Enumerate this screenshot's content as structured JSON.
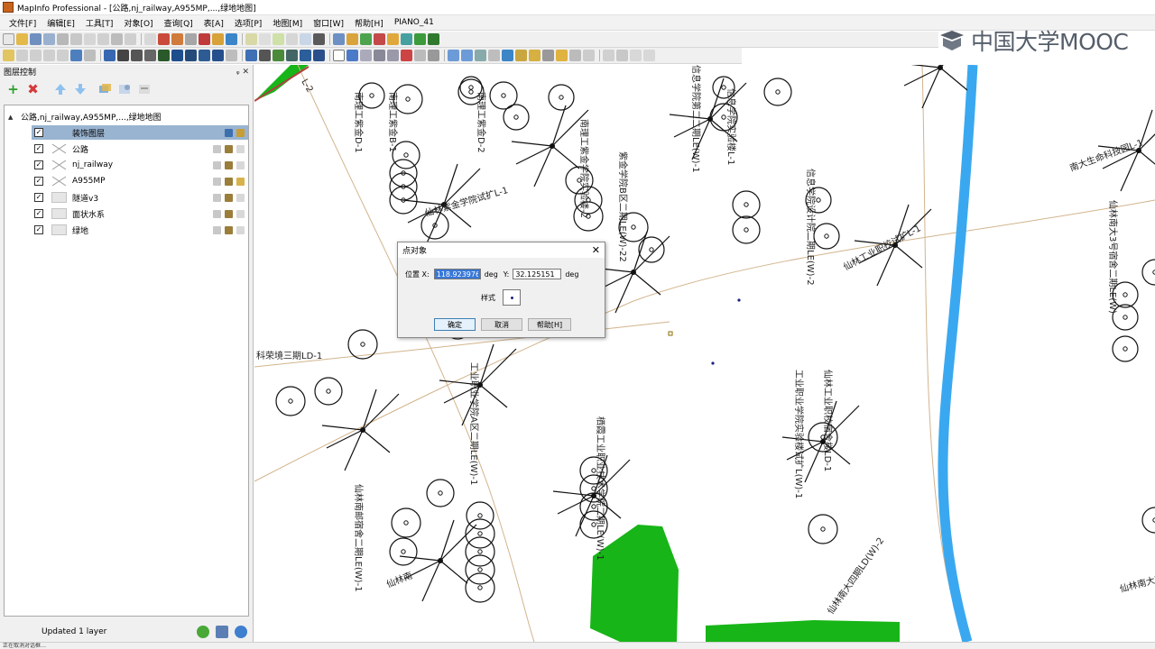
{
  "window": {
    "title": "MapInfo Professional - [公路,nj_railway,A955MP,...,绿地地图]"
  },
  "menu": {
    "items": [
      "文件[F]",
      "编辑[E]",
      "工具[T]",
      "对象[O]",
      "查询[Q]",
      "表[A]",
      "选项[P]",
      "地图[M]",
      "窗口[W]",
      "帮助[H]",
      "PIANO_41"
    ]
  },
  "logo": {
    "text": "中国大学MOOC",
    "color": "#555e6a"
  },
  "layer_panel": {
    "title": "图层控制",
    "header_buttons": "ᵩ ✕",
    "add_icon": "+",
    "remove_icon": "✖",
    "root_label": "公路,nj_railway,A955MP,...,绿地地图",
    "root_expander": "▲",
    "layers": [
      {
        "name": "装饰图层",
        "checked": "✓",
        "selected": true
      },
      {
        "name": "公路",
        "checked": "✓"
      },
      {
        "name": "nj_railway",
        "checked": "✓"
      },
      {
        "name": "A955MP",
        "checked": "✓"
      },
      {
        "name": "隧道v3",
        "checked": "✓"
      },
      {
        "name": "面状水系",
        "checked": "✓"
      },
      {
        "name": "绿地",
        "checked": "✓"
      }
    ],
    "status_text": "Updated 1 layer"
  },
  "dialog": {
    "title": "点对象",
    "close": "✕",
    "position_label": "位置 X:",
    "x_value": "118.923976",
    "x_unit": "deg",
    "y_label": "Y:",
    "y_value": "32.125151",
    "y_unit": "deg",
    "style_label": "样式",
    "ok_label": "确定",
    "cancel_label": "取消",
    "help_label": "帮助[H]"
  },
  "map": {
    "colors": {
      "river": "#3aa8f0",
      "green": "#17b517",
      "road": "#d2b48c",
      "symbol": "#111111"
    },
    "labels": [
      "南理工紫金D-1",
      "南理工紫金D-2",
      "南理工紫金B-1",
      "南理工紫金学院实验楼-2",
      "仙林紫金学院试扩L-1",
      "信息学院第二二期LE(W)-1",
      "信息学院实验楼L-1",
      "信息学院设计院二期LE(W)-2",
      "仙林工业职校试扩L-1",
      "仙林工业职校宿舍楼LD-1",
      "工业职业学院实验楼试扩L(W)-1",
      "科荣境三期LD-1",
      "南大生命科技园L-1",
      "仙林南大3号宿舍二期LE(W)",
      "仙林南大四",
      "仙林南邮宿舍二期LE(W)-1",
      "栖霞工业职业技术学院二期LE(W)-1",
      "工业职业学院A区二期LE(W)-1",
      "仙林南",
      "紫金学院B区二期LE(W)-22",
      "L-2",
      "仙林南大四期LD(W)-2"
    ]
  },
  "status_bar": {
    "text": "正在取消对话框…"
  }
}
